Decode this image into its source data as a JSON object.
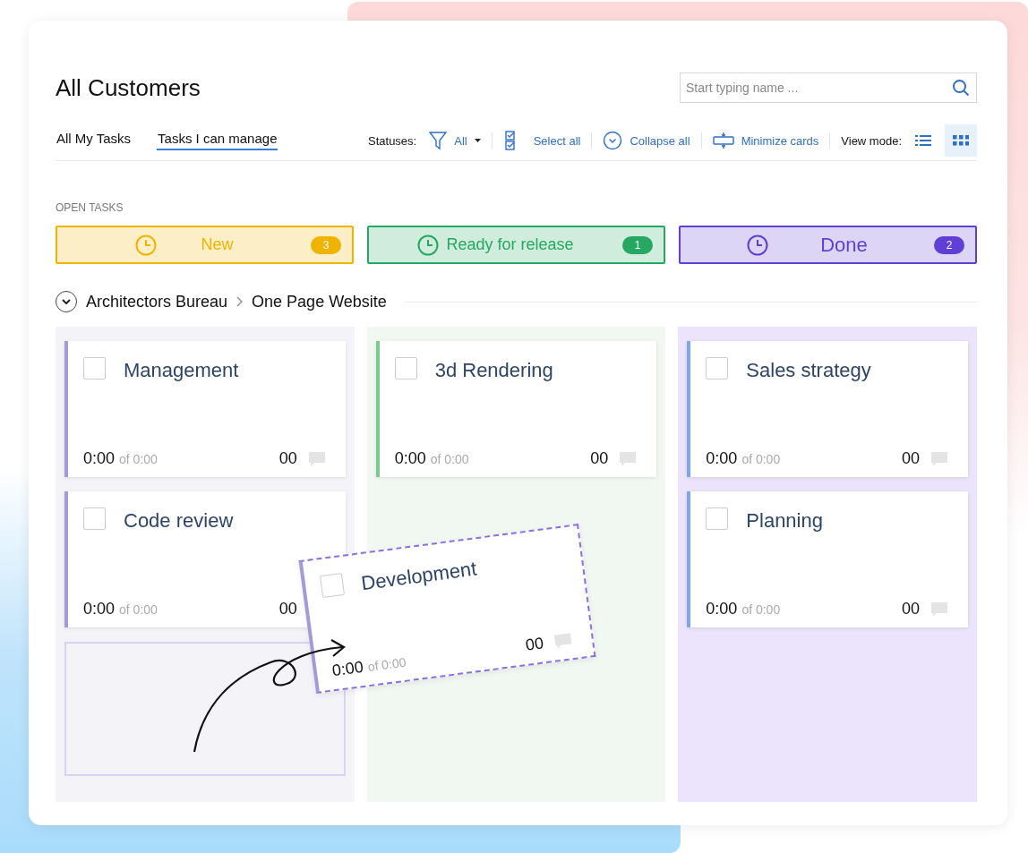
{
  "title": "All Customers",
  "search": {
    "placeholder": "Start typing name ..."
  },
  "tabs": [
    {
      "label": "All My Tasks",
      "selected": false
    },
    {
      "label": "Tasks I can manage",
      "selected": true
    }
  ],
  "toolbar": {
    "statuses_label": "Statuses:",
    "filter": "All",
    "actions": [
      {
        "kind": "select",
        "label": "Select all"
      },
      {
        "kind": "collapse",
        "label": "Collapse all"
      },
      {
        "kind": "minimize",
        "label": "Minimize cards"
      }
    ],
    "view_label": "View mode:",
    "view_modes": [
      {
        "kind": "list",
        "selected": false
      },
      {
        "kind": "grid",
        "selected": true
      }
    ]
  },
  "section": "OPEN TASKS",
  "statuses": [
    {
      "name": "New",
      "count": "3",
      "color": "#f0b400"
    },
    {
      "name": "Ready for release",
      "count": "1",
      "color": "#27a862"
    },
    {
      "name": "Done",
      "count": "2",
      "color": "#5f3fd6"
    }
  ],
  "group": {
    "expanded": true,
    "client": "Architectors Bureau",
    "project": "One Page Website"
  },
  "columns": [
    {
      "drop_slot": true,
      "cards": [
        {
          "title": "Management",
          "checked": false,
          "time": "0:00",
          "estimate": "of 0:00",
          "comments": "00",
          "color": "#a49bd6"
        },
        {
          "title": "Code review",
          "checked": false,
          "time": "0:00",
          "estimate": "of 0:00",
          "comments": "00",
          "color": "#a49bd6"
        }
      ]
    },
    {
      "drop_slot": false,
      "cards": [
        {
          "title": "3d Rendering",
          "checked": false,
          "time": "0:00",
          "estimate": "of 0:00",
          "comments": "00",
          "color": "#7ccb8e"
        }
      ]
    },
    {
      "drop_slot": false,
      "cards": [
        {
          "title": "Sales strategy",
          "checked": false,
          "time": "0:00",
          "estimate": "of 0:00",
          "comments": "00",
          "color": "#7ea6ea"
        },
        {
          "title": "Planning",
          "checked": false,
          "time": "0:00",
          "estimate": "of 0:00",
          "comments": "00",
          "color": "#7ea6ea"
        }
      ]
    }
  ],
  "dragged_card": {
    "title": "Development",
    "checked": false,
    "time": "0:00",
    "estimate": "of 0:00",
    "comments": "00",
    "color": "#a49bd6"
  }
}
